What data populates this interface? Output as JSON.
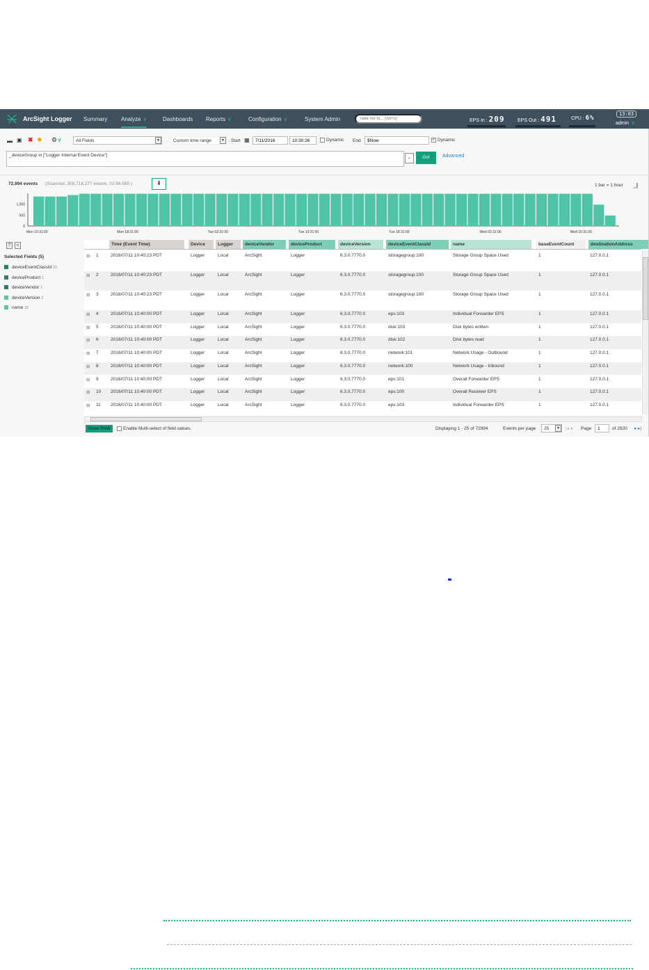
{
  "app": {
    "title": "ArcSight Logger",
    "nav": [
      {
        "label": "Summary"
      },
      {
        "label": "Analyze",
        "active": true,
        "dropdown": true
      },
      {
        "label": "Dashboards"
      },
      {
        "label": "Reports",
        "dropdown": true
      },
      {
        "label": "Configuration",
        "dropdown": true
      },
      {
        "label": "System Admin"
      }
    ],
    "search_placeholder": "Take me to... (Alt+o)",
    "eps_in_label": "EPS In :",
    "eps_in": "209",
    "eps_out_label": "EPS Out :",
    "eps_out": "491",
    "cpu_label": "CPU :",
    "cpu": "6%",
    "clock": "13:03",
    "user": "admin"
  },
  "toolbar": {
    "fields": "All Fields",
    "time_range": "Custom time range",
    "start_label": "Start",
    "start_date": "7/11/2016",
    "start_time": "10:30:26",
    "dynamic_label": "Dynamic",
    "end_label": "End",
    "end_value": "$Now",
    "end_dynamic_label": "Dynamic",
    "end_dynamic_checked": true,
    "go_label": "Go!",
    "advanced_label": "Advanced"
  },
  "query": "_deviceGroup in [\"Logger Internal Event Device\"]",
  "summary": {
    "events": "72,994 events",
    "scanned": "(Scanned: 358,718,277 events,  02:56.585 )",
    "bar_scale": "1 bar = 1 hour"
  },
  "chart_data": {
    "type": "bar",
    "yticks": [
      "0",
      "500",
      "1,000"
    ],
    "ylim": [
      0,
      1500
    ],
    "xticks": [
      "Mon 10:31:00",
      "Mon 18:31:00",
      "Tue 02:31:00",
      "Tue 10:31:00",
      "Tue 18:31:00",
      "Wed 02:31:00",
      "Wed 10:31:00"
    ],
    "values": [
      1350,
      1350,
      1350,
      1420,
      1480,
      1480,
      1480,
      1480,
      1480,
      1480,
      1480,
      1480,
      1480,
      1480,
      1480,
      1480,
      1480,
      1480,
      1480,
      1480,
      1480,
      1480,
      1480,
      1480,
      1480,
      1480,
      1480,
      1480,
      1480,
      1480,
      1480,
      1480,
      1480,
      1480,
      1480,
      1480,
      1480,
      1480,
      1480,
      1480,
      1480,
      1480,
      1480,
      1480,
      1480,
      1480,
      1480,
      1480,
      1480,
      980,
      480
    ],
    "color": "#4fc4a6"
  },
  "selected_fields": {
    "title": "Selected Fields (5)",
    "items": [
      {
        "name": "deviceEventClassId",
        "count": "33",
        "color": "#2a7f6a"
      },
      {
        "name": "deviceProduct",
        "count": "1",
        "color": "#2a7f6a"
      },
      {
        "name": "deviceVendor",
        "count": "1",
        "color": "#2a7f6a"
      },
      {
        "name": "deviceVersion",
        "count": "2",
        "color": "#5cc49a"
      },
      {
        "name": "name",
        "count": "32",
        "color": "#5cc49a"
      }
    ]
  },
  "table": {
    "columns": [
      "Time (Event Time)",
      "Device",
      "Logger",
      "deviceVendor",
      "deviceProduct",
      "deviceVersion",
      "deviceEventClassId",
      "name",
      "baseEventCount",
      "destinationAddress"
    ],
    "rows": [
      [
        "1",
        "2016/07/11 10:40:23 PDT",
        "Logger",
        "Local",
        "ArcSight",
        "Logger",
        "6.3.0.7770.0",
        "storagegroup:100",
        "Storage Group Space Used",
        "1",
        "127.0.0.1"
      ],
      [
        "2",
        "2016/07/11 10:40:23 PDT",
        "Logger",
        "Local",
        "ArcSight",
        "Logger",
        "6.3.0.7770.0",
        "storagegroup:100",
        "Storage Group Space Used",
        "1",
        "127.0.0.1"
      ],
      [
        "3",
        "2016/07/11 10:40:23 PDT",
        "Logger",
        "Local",
        "ArcSight",
        "Logger",
        "6.3.0.7770.0",
        "storagegroup:100",
        "Storage Group Space Used",
        "1",
        "127.0.0.1"
      ],
      [
        "4",
        "2016/07/11 10:40:00 PDT",
        "Logger",
        "Local",
        "ArcSight",
        "Logger",
        "6.3.0.7770.0",
        "eps:103",
        "Individual Forwarder EPS",
        "1",
        "127.0.0.1"
      ],
      [
        "5",
        "2016/07/11 10:40:00 PDT",
        "Logger",
        "Local",
        "ArcSight",
        "Logger",
        "6.3.0.7770.0",
        "disk:103",
        "Disk bytes written",
        "1",
        "127.0.0.1"
      ],
      [
        "6",
        "2016/07/11 10:40:00 PDT",
        "Logger",
        "Local",
        "ArcSight",
        "Logger",
        "6.3.0.7770.0",
        "disk:102",
        "Disk bytes read",
        "1",
        "127.0.0.1"
      ],
      [
        "7",
        "2016/07/11 10:40:00 PDT",
        "Logger",
        "Local",
        "ArcSight",
        "Logger",
        "6.3.0.7770.0",
        "network:101",
        "Network Usage - Outbound",
        "1",
        "127.0.0.1"
      ],
      [
        "8",
        "2016/07/11 10:40:00 PDT",
        "Logger",
        "Local",
        "ArcSight",
        "Logger",
        "6.3.0.7770.0",
        "network:100",
        "Network Usage - Inbound",
        "1",
        "127.0.0.1"
      ],
      [
        "9",
        "2016/07/11 10:40:00 PDT",
        "Logger",
        "Local",
        "ArcSight",
        "Logger",
        "6.3.0.7770.0",
        "eps:101",
        "Overall Forwarder EPS",
        "1",
        "127.0.0.1"
      ],
      [
        "10",
        "2016/07/11 10:40:00 PDT",
        "Logger",
        "Local",
        "ArcSight",
        "Logger",
        "6.3.0.7770.0",
        "eps:100",
        "Overall Receiver EPS",
        "1",
        "127.0.0.1"
      ],
      [
        "11",
        "2016/07/11 10:40:00 PDT",
        "Logger",
        "Local",
        "ArcSight",
        "Logger",
        "6.3.0.7770.0",
        "eps:103",
        "Individual Forwarder EPS",
        "1",
        "127.0.0.1"
      ]
    ]
  },
  "footer": {
    "show_raw": "Show RAW",
    "multiselect": "Enable Multi-select of field values.",
    "displaying": "Displaying 1 - 25 of 72994",
    "per_page_label": "Events per page",
    "per_page": "25",
    "page_label": "Page",
    "page": "1",
    "of_pages": "of 2920"
  }
}
